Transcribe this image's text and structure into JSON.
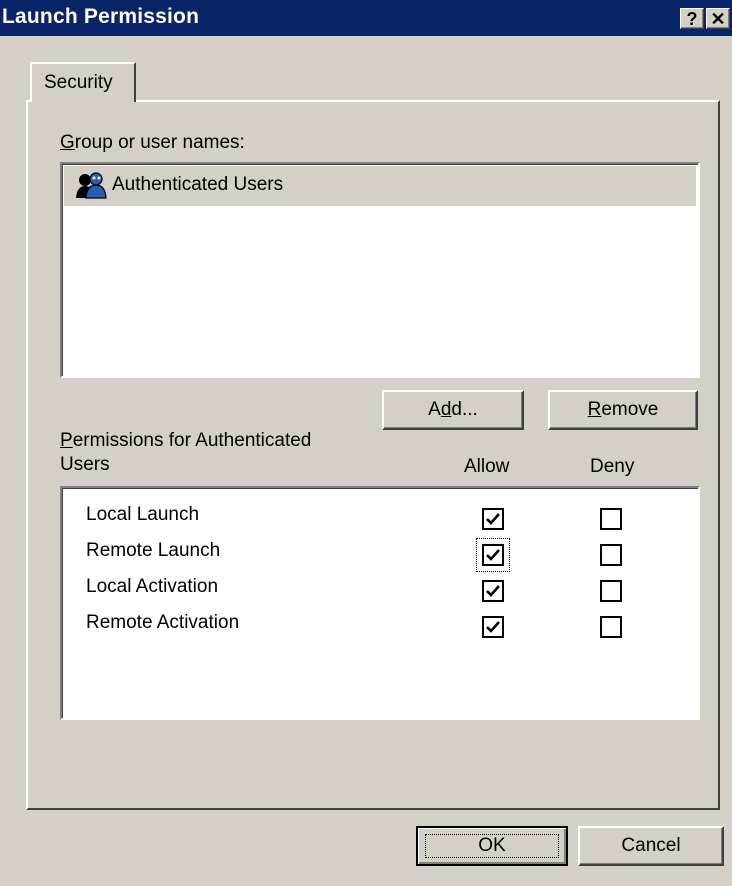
{
  "window": {
    "title": "Launch Permission",
    "help_glyph": "?",
    "close_glyph": "✕"
  },
  "tabs": [
    {
      "label": "Security",
      "selected": true
    }
  ],
  "groups": {
    "label_first": "G",
    "label_rest": "roup or user names:",
    "items": [
      {
        "name": "Authenticated Users",
        "icon": "group-users-icon",
        "selected": true
      }
    ]
  },
  "buttons": {
    "add": {
      "pre": "A",
      "mnemonic": "d",
      "post": "d..."
    },
    "remove": {
      "mnemonic": "R",
      "post": "emove"
    },
    "ok": "OK",
    "cancel": "Cancel"
  },
  "permissions": {
    "label_first": "P",
    "label_line1": "ermissions for Authenticated",
    "label_line2": "Users",
    "allow_header": "Allow",
    "deny_header": "Deny",
    "rows": [
      {
        "name": "Local Launch",
        "allow": true,
        "deny": false
      },
      {
        "name": "Remote Launch",
        "allow": true,
        "deny": false
      },
      {
        "name": "Local Activation",
        "allow": true,
        "deny": false
      },
      {
        "name": "Remote Activation",
        "allow": true,
        "deny": false
      }
    ]
  }
}
